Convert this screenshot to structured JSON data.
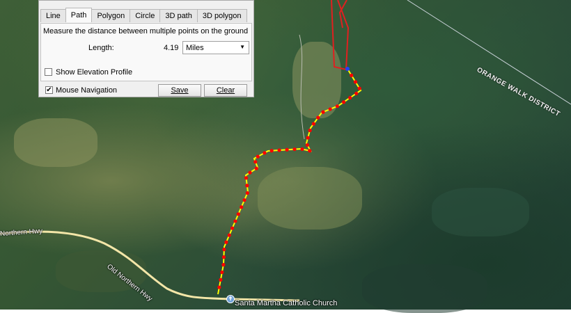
{
  "panel": {
    "tabs": [
      "Line",
      "Path",
      "Polygon",
      "Circle",
      "3D path",
      "3D polygon"
    ],
    "active_tab": "Path",
    "description": "Measure the distance between multiple points on the ground",
    "length_label": "Length:",
    "length_value": "4.19",
    "unit_selected": "Miles",
    "elevation_label": "Show Elevation Profile",
    "elevation_checked": false,
    "mouse_nav_label": "Mouse Navigation",
    "mouse_nav_checked": true,
    "save_label": "Save",
    "clear_label": "Clear"
  },
  "map": {
    "road_label_1": "Northern Hwy",
    "road_label_2": "Old Northern Hwy",
    "district_label": "ORANGE WALK DISTRICT",
    "place_label": "Santa Martha Catholic Church",
    "colors": {
      "path_line": "#ffff00",
      "path_points": "#ff0000",
      "boundary": "#e02020",
      "road": "#f3e6a8"
    }
  }
}
